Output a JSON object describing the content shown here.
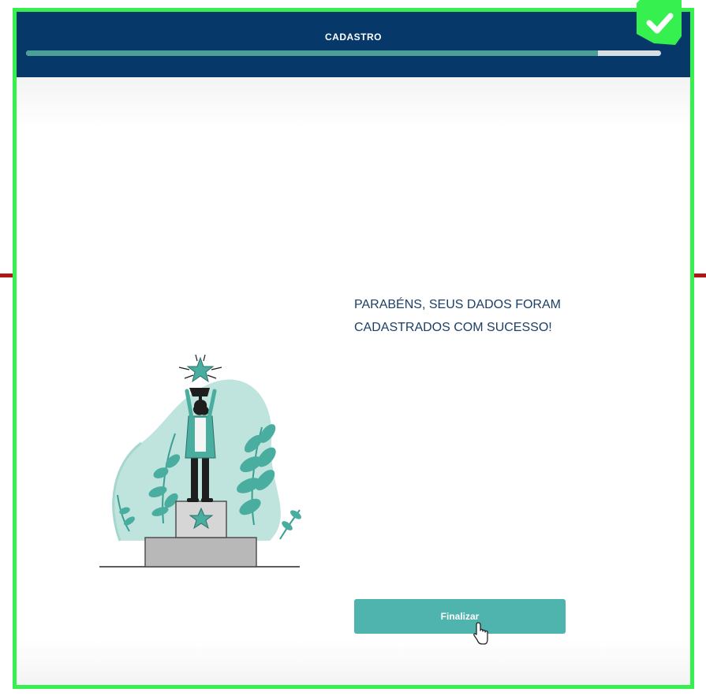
{
  "header": {
    "title": "CADASTRO",
    "progress": 0.9
  },
  "message": {
    "line1": "PARABÉNS, SEUS DADOS FORAM",
    "line2": "CADASTRADOS COM SUCESSO!"
  },
  "actions": {
    "finalize_label": "Finalizar"
  },
  "icons": {
    "badge": "check-icon",
    "cursor": "hand-pointer-icon",
    "illustration": "trophy-podium-illustration"
  },
  "colors": {
    "header": "#06396a",
    "accent": "#4fb4ad",
    "badge": "#35f04f",
    "text": "#1b3f67"
  }
}
